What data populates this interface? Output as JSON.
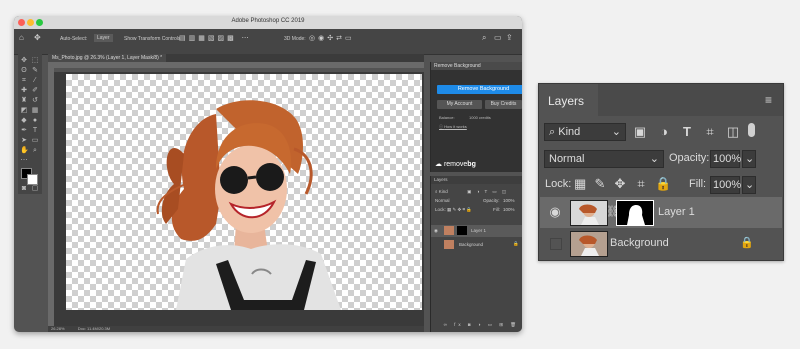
{
  "window": {
    "title": "Adobe Photoshop CC 2019",
    "traffic_colors": [
      "#fc5f57",
      "#fdbc2e",
      "#28c840"
    ]
  },
  "options_bar": {
    "auto_select": "Auto-Select:",
    "auto_select_value": "Layer",
    "show_transform": "Show Transform Controls",
    "mode_3d": "3D Mode:"
  },
  "document_tab": "Ms_Photo.jpg @ 26.3% (Layer 1, Layer Mask/8) *",
  "status_bar": {
    "zoom": "26.28%",
    "doc": "Doc: 11.4M/20.3M"
  },
  "remove_bg_panel": {
    "header": "Remove Background",
    "primary_button": "Remove Background",
    "account_button": "My Account",
    "credits_button": "Buy Credits",
    "balance_label": "Balance:",
    "balance_value": "1000 credits",
    "help_link": "How it works",
    "logo_text": "remove",
    "logo_text_bold": "bg",
    "accent": "#1e8be8"
  },
  "layers_small": {
    "tab": "Layers",
    "kind": "Kind",
    "blend": "Normal",
    "opacity_label": "Opacity:",
    "opacity": "100%",
    "lock_label": "Lock:",
    "fill_label": "Fill:",
    "fill": "100%",
    "layers": [
      {
        "name": "Layer 1",
        "selected": true
      },
      {
        "name": "Background",
        "selected": false
      }
    ]
  },
  "layers_panel": {
    "tab": "Layers",
    "filter_kind": "Kind",
    "blend_mode": "Normal",
    "opacity_label": "Opacity:",
    "opacity_value": "100%",
    "lock_label": "Lock:",
    "fill_label": "Fill:",
    "fill_value": "100%",
    "layers": [
      {
        "name": "Layer 1",
        "visible": true,
        "has_mask": true,
        "selected": true
      },
      {
        "name": "Background",
        "visible": false,
        "locked": true,
        "selected": false
      }
    ]
  }
}
